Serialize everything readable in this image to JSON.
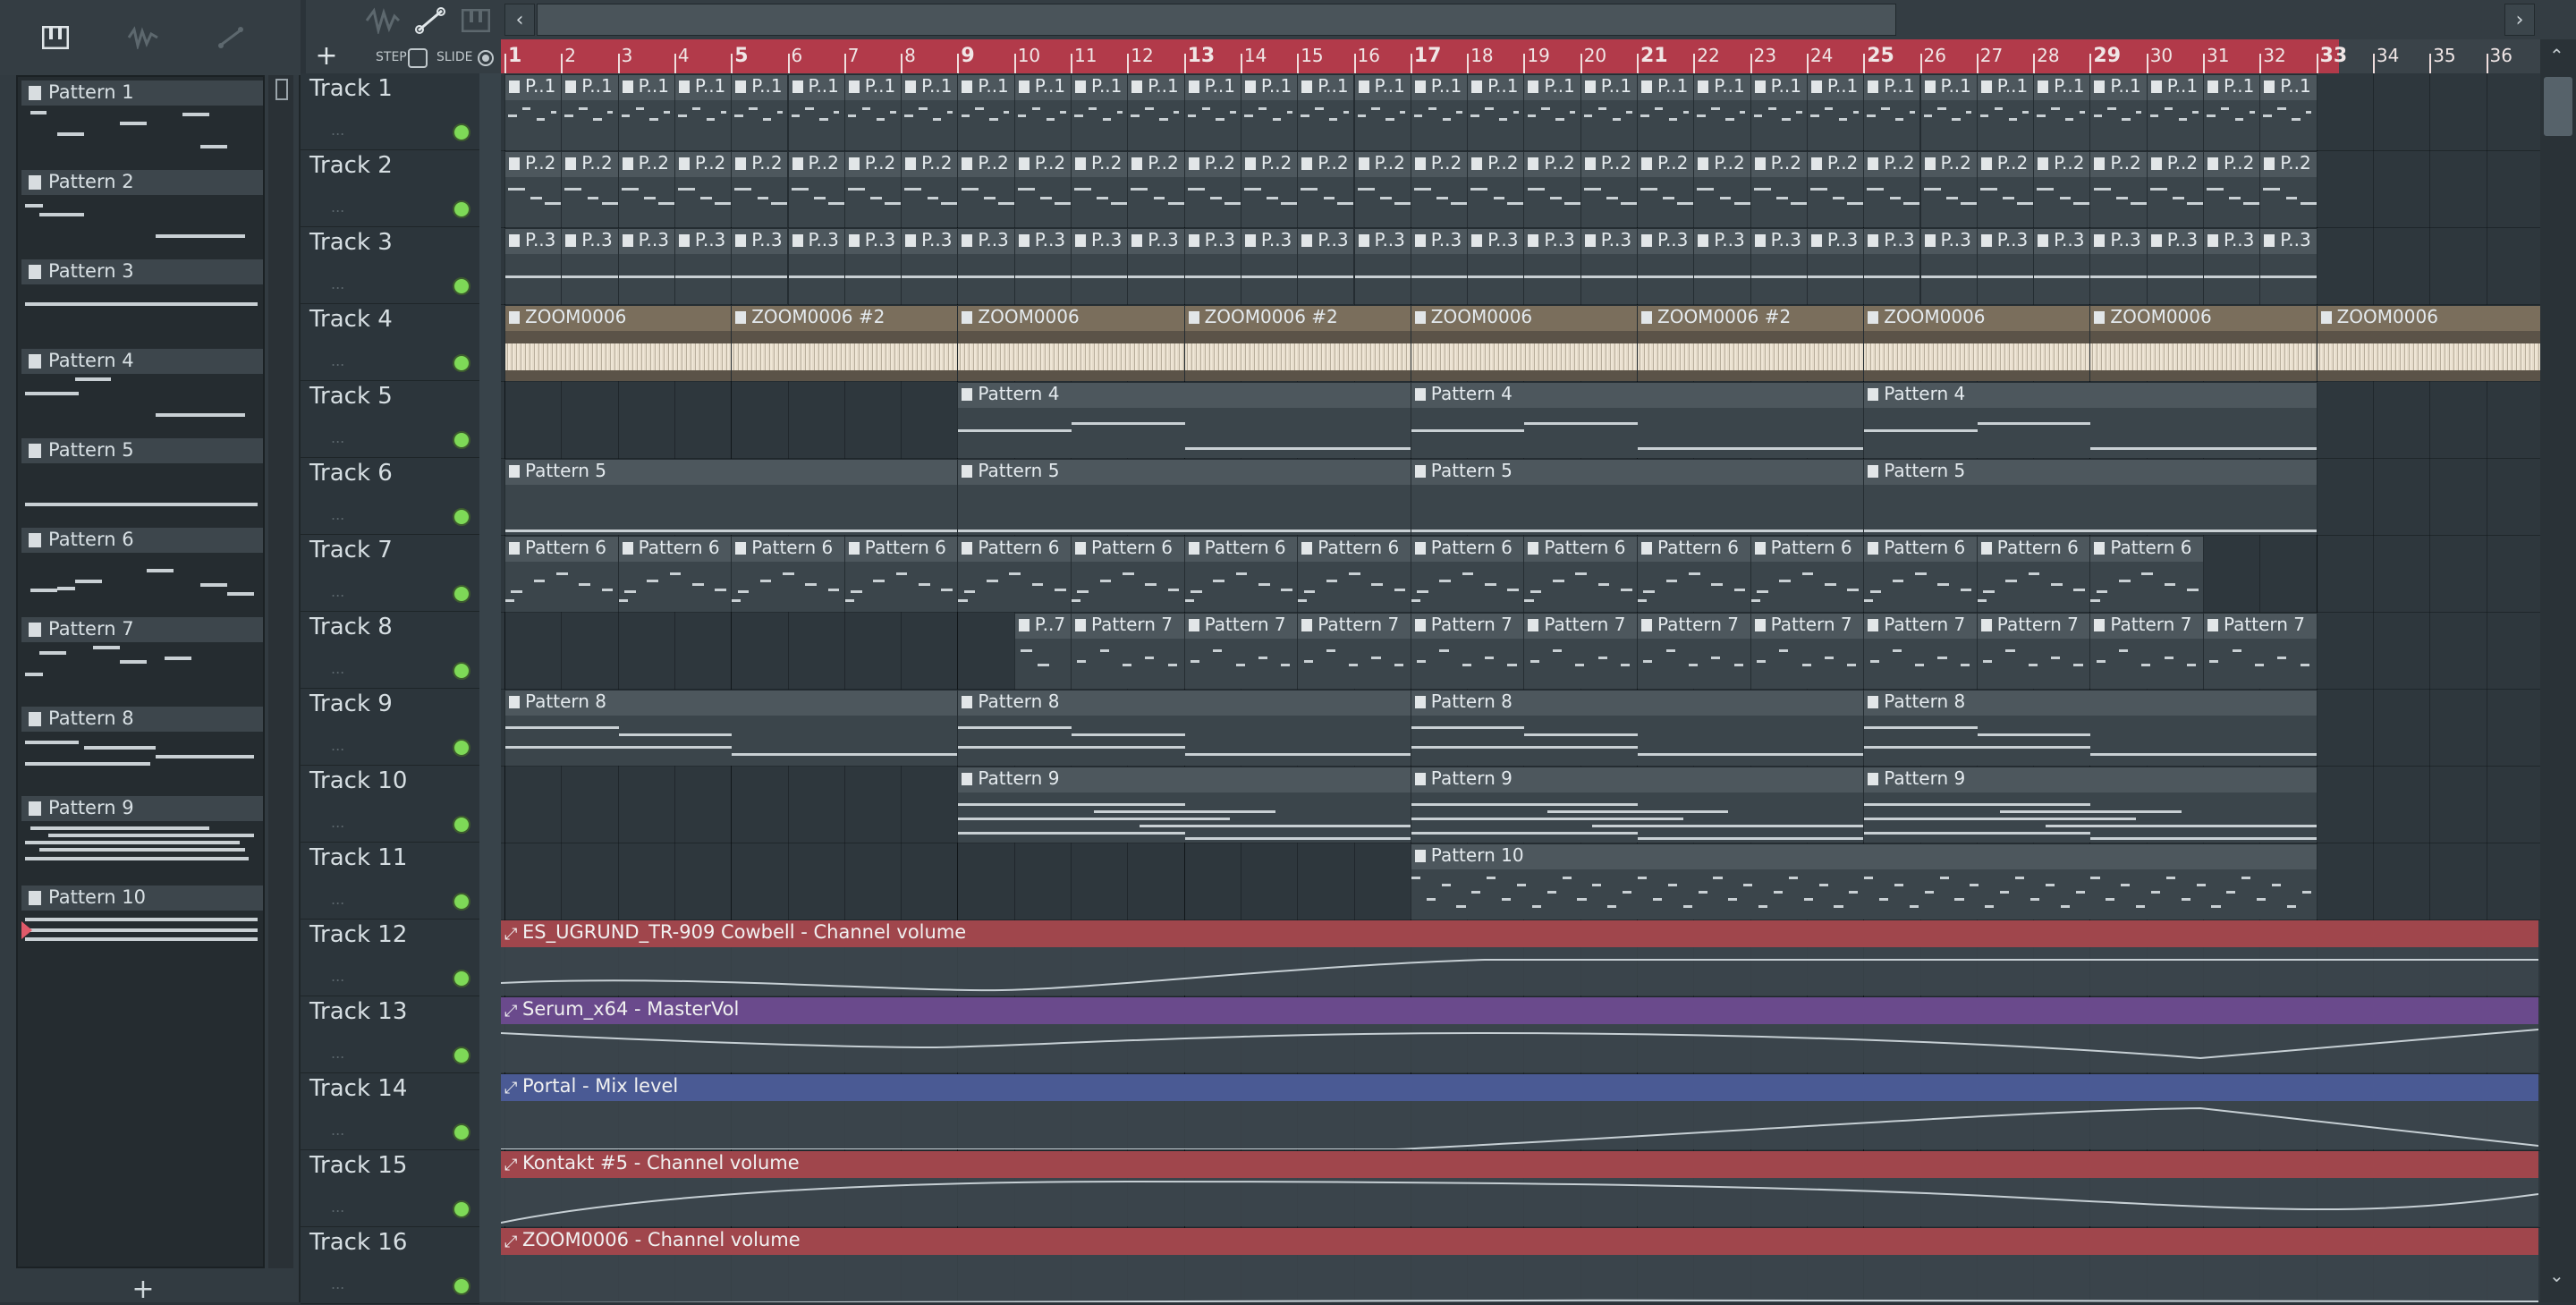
{
  "left_toolbar": {
    "icons": [
      "piano-roll-icon",
      "audio-clip-icon",
      "automation-icon"
    ]
  },
  "patterns": [
    "Pattern 1",
    "Pattern 2",
    "Pattern 3",
    "Pattern 4",
    "Pattern 5",
    "Pattern 6",
    "Pattern 7",
    "Pattern 8",
    "Pattern 9",
    "Pattern 10"
  ],
  "add_label": "+",
  "toolbar": {
    "add_label": "+",
    "step_label": "STEP",
    "slide_label": "SLIDE"
  },
  "ruler": {
    "bars": [
      "1",
      "2",
      "3",
      "4",
      "5",
      "6",
      "7",
      "8",
      "9",
      "10",
      "11",
      "12",
      "13",
      "14",
      "15",
      "16",
      "17",
      "18",
      "19",
      "20",
      "21",
      "22",
      "23",
      "24",
      "25",
      "26",
      "27",
      "28",
      "29",
      "30",
      "31",
      "32",
      "33",
      "34",
      "35",
      "36"
    ]
  },
  "tracks": [
    "Track 1",
    "Track 2",
    "Track 3",
    "Track 4",
    "Track 5",
    "Track 6",
    "Track 7",
    "Track 8",
    "Track 9",
    "Track 10",
    "Track 11",
    "Track 12",
    "Track 13",
    "Track 14",
    "Track 15",
    "Track 16"
  ],
  "clip_labels": {
    "p1_short": "P..1",
    "p2_short": "P..2",
    "p3_short": "P..3",
    "audio": "ZOOM0006",
    "audio2": "ZOOM0006 #2",
    "p4": "Pattern 4",
    "p5": "Pattern 5",
    "p6": "Pattern 6",
    "p7": "Pattern 7",
    "p7_short": "P..7",
    "p8": "Pattern 8",
    "p9": "Pattern 9",
    "p10": "Pattern 10"
  },
  "automation": [
    {
      "label": "ES_UGRUND_TR-909 Cowbell - Channel volume",
      "color": "#a0464c"
    },
    {
      "label": "Serum_x64 - MasterVol",
      "color": "#6a4a8c"
    },
    {
      "label": "Portal - Mix level",
      "color": "#4a5a94"
    },
    {
      "label": "Kontakt #5 - Channel volume",
      "color": "#a0464c"
    },
    {
      "label": "ZOOM0006 - Channel volume",
      "color": "#a0464c"
    }
  ]
}
